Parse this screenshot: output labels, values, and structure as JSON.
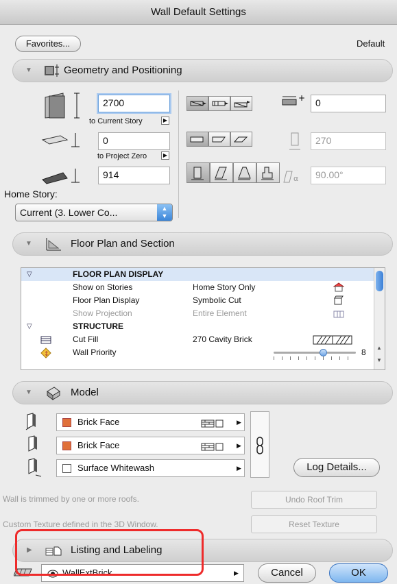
{
  "window": {
    "title": "Wall Default Settings"
  },
  "top": {
    "favorites_label": "Favorites...",
    "default_label": "Default"
  },
  "geometry": {
    "title": "Geometry and Positioning",
    "height_value": "2700",
    "to_current_story": "to Current Story",
    "base_offset_value": "0",
    "to_project_zero": "to Project Zero",
    "thickness_value": "914",
    "home_story_label": "Home Story:",
    "home_story_value": "Current (3. Lower Co...",
    "offset_value": "0",
    "slant_value": "270",
    "angle_value": "90.00°"
  },
  "floorplan": {
    "title": "Floor Plan and Section",
    "rows": [
      {
        "label": "FLOOR PLAN DISPLAY",
        "value": ""
      },
      {
        "label": "Show on Stories",
        "value": "Home Story Only"
      },
      {
        "label": "Floor Plan Display",
        "value": "Symbolic Cut"
      },
      {
        "label": "Show Projection",
        "value": "Entire Element"
      },
      {
        "label": "STRUCTURE",
        "value": ""
      },
      {
        "label": "Cut Fill",
        "value": "270 Cavity Brick"
      },
      {
        "label": "Wall Priority",
        "value": "8"
      }
    ]
  },
  "model": {
    "title": "Model",
    "surfaces": [
      {
        "label": "Brick Face",
        "color": "#e0703a"
      },
      {
        "label": "Brick Face",
        "color": "#e0703a"
      },
      {
        "label": "Surface Whitewash",
        "color": "#ffffff"
      }
    ],
    "log_details_label": "Log Details...",
    "trim_text": "Wall is trimmed by one or more roofs.",
    "undo_roof_trim_label": "Undo Roof Trim",
    "custom_texture_text": "Custom Texture defined in the 3D Window.",
    "reset_texture_label": "Reset Texture"
  },
  "listing": {
    "title": "Listing and Labeling"
  },
  "footer": {
    "layer_value": "WallExtBrick",
    "cancel_label": "Cancel",
    "ok_label": "OK"
  },
  "colors": {
    "ok_blue": "#7fb7ef",
    "highlight_red": "#ee2b2b",
    "list_header": "#d9e6f7"
  }
}
